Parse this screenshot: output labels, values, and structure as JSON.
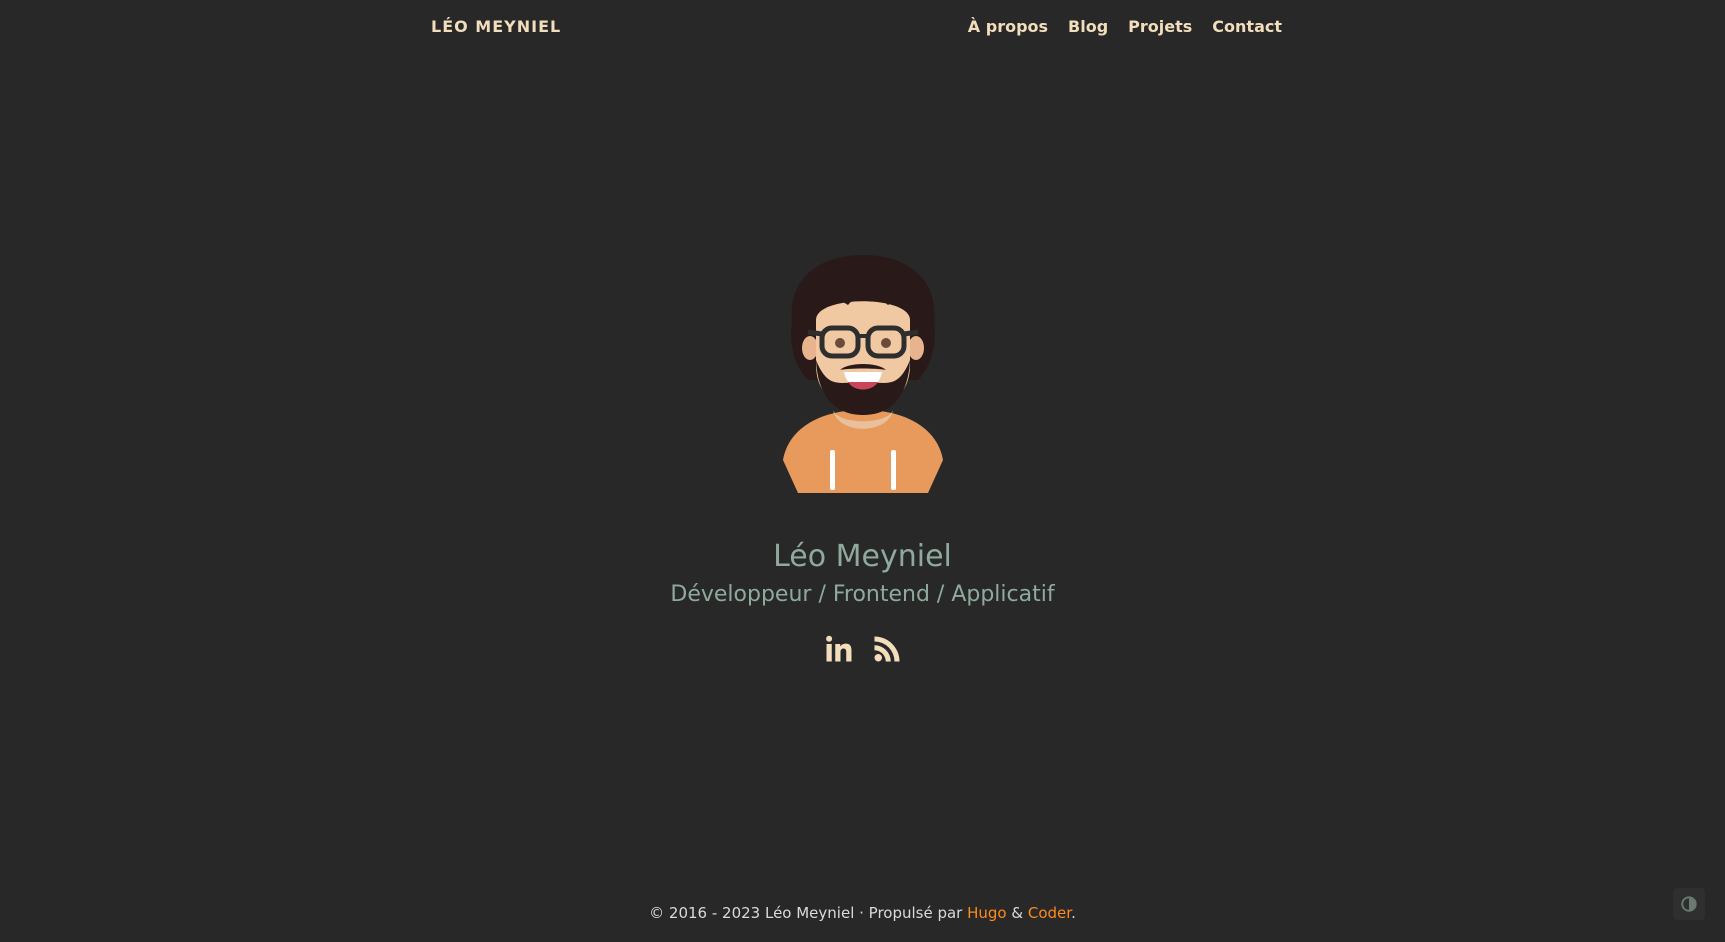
{
  "header": {
    "brand": "LÉO MEYNIEL",
    "nav": [
      {
        "label": "À propos"
      },
      {
        "label": "Blog"
      },
      {
        "label": "Projets"
      },
      {
        "label": "Contact"
      }
    ]
  },
  "profile": {
    "name": "Léo Meyniel",
    "tagline": "Développeur / Frontend / Applicatif",
    "avatar_icon": "avatar-illustration"
  },
  "socials": [
    {
      "icon": "linkedin-icon"
    },
    {
      "icon": "rss-icon"
    }
  ],
  "footer": {
    "copyright": "© 2016 - 2023 Léo Meyniel · Propulsé par ",
    "hugo": "Hugo",
    "amp": " & ",
    "coder": "Coder",
    "period": "."
  },
  "theme_toggle": {
    "icon": "contrast-icon"
  },
  "colors": {
    "background": "#282828",
    "nav_text": "#f2ddbc",
    "heading": "#8faa9c",
    "link_accent": "#ff8a1c"
  }
}
